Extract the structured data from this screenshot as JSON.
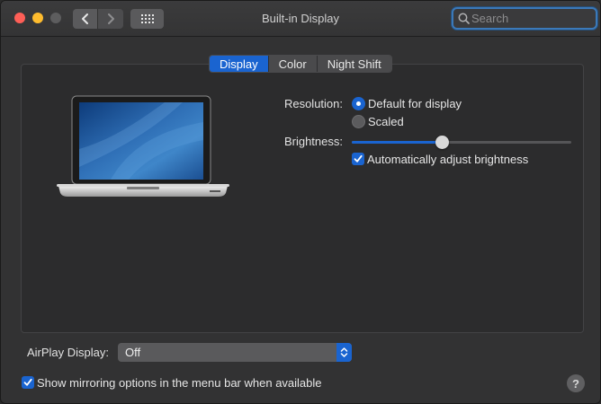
{
  "window": {
    "title": "Built-in Display"
  },
  "toolbar": {
    "back_icon": "chevron-left-icon",
    "forward_icon": "chevron-right-icon",
    "show_all_icon": "grid-icon"
  },
  "search": {
    "placeholder": "Search",
    "value": ""
  },
  "tabs": [
    {
      "label": "Display",
      "active": true
    },
    {
      "label": "Color",
      "active": false
    },
    {
      "label": "Night Shift",
      "active": false
    }
  ],
  "resolution": {
    "label": "Resolution:",
    "options": [
      {
        "label": "Default for display",
        "selected": true
      },
      {
        "label": "Scaled",
        "selected": false
      }
    ]
  },
  "brightness": {
    "label": "Brightness:",
    "level": 0.41,
    "auto_adjust_label": "Automatically adjust brightness",
    "auto_adjust_checked": true
  },
  "airplay": {
    "label": "AirPlay Display:",
    "value": "Off"
  },
  "mirroring": {
    "label": "Show mirroring options in the menu bar when available",
    "checked": true
  },
  "help": {
    "label": "?"
  },
  "colors": {
    "accent": "#1a64d0",
    "window_bg": "#323233",
    "panel_bg": "#2c2c2d"
  }
}
